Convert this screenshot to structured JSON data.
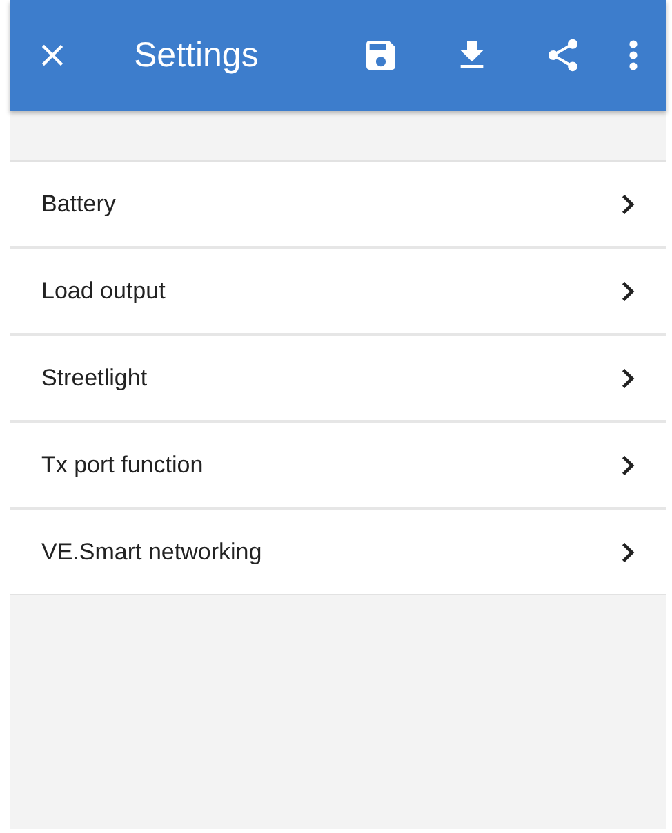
{
  "header": {
    "title": "Settings"
  },
  "items": [
    {
      "label": "Battery"
    },
    {
      "label": "Load output"
    },
    {
      "label": "Streetlight"
    },
    {
      "label": "Tx port function"
    },
    {
      "label": "VE.Smart networking"
    }
  ]
}
